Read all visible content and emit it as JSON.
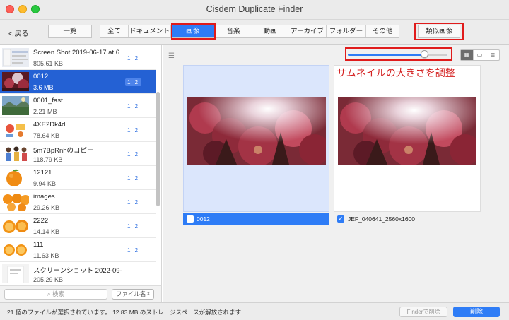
{
  "window": {
    "title": "Cisdem Duplicate Finder"
  },
  "toolbar": {
    "back_label": "< 戻る",
    "overview_label": "一覧",
    "categories": [
      {
        "label": "全て",
        "active": false
      },
      {
        "label": "ドキュメント",
        "active": false
      },
      {
        "label": "画像",
        "active": true
      },
      {
        "label": "音楽",
        "active": false
      },
      {
        "label": "動画",
        "active": false
      },
      {
        "label": "アーカイブ",
        "active": false
      },
      {
        "label": "フォルダー",
        "active": false
      },
      {
        "label": "その他",
        "active": false
      }
    ],
    "similar_images_label": "類似画像"
  },
  "sidebar": {
    "items": [
      {
        "name": "Screen Shot 2019-06-17 at 6....",
        "size": "805.61 KB",
        "badge": "1 2",
        "selected": false,
        "thumb": "screenshot"
      },
      {
        "name": "0012",
        "size": "3.6 MB",
        "badge": "1 2",
        "selected": true,
        "thumb": "autumn-tree"
      },
      {
        "name": "0001_fast",
        "size": "2.21 MB",
        "badge": "1 2",
        "selected": false,
        "thumb": "landscape"
      },
      {
        "name": "4XE2Dk4d",
        "size": "78.64 KB",
        "badge": "1 2",
        "selected": false,
        "thumb": "illustration"
      },
      {
        "name": "5m7BpRnhのコピー",
        "size": "118.79 KB",
        "badge": "1 2",
        "selected": false,
        "thumb": "people"
      },
      {
        "name": "12121",
        "size": "9.94 KB",
        "badge": "1 2",
        "selected": false,
        "thumb": "orange"
      },
      {
        "name": "images",
        "size": "29.26 KB",
        "badge": "1 2",
        "selected": false,
        "thumb": "oranges"
      },
      {
        "name": "2222",
        "size": "14.14 KB",
        "badge": "1 2",
        "selected": false,
        "thumb": "orange-slices"
      },
      {
        "name": "111",
        "size": "11.63 KB",
        "badge": "1 2",
        "selected": false,
        "thumb": "orange-halves"
      },
      {
        "name": "スクリーンショット 2022-09-0...",
        "size": "205.29 KB",
        "badge": "",
        "selected": false,
        "thumb": "screenshot-2"
      }
    ],
    "search_placeholder": "検索",
    "sort_label": "ファイル名"
  },
  "main": {
    "annotation": "サムネイルの大きさを調整",
    "thumb_size_fraction": 0.78,
    "view_icons": [
      "grid-view-icon",
      "filmstrip-view-icon",
      "list-view-icon"
    ],
    "cards": [
      {
        "label": "0012",
        "checked": false,
        "selected": true
      },
      {
        "label": "JEF_040641_2560x1600",
        "checked": true,
        "selected": false
      }
    ]
  },
  "footer": {
    "status": "21 個のファイルが選択されています。 12.83 MB のストレージスペースが解放されます",
    "finder_delete_label": "Finderで削除",
    "delete_label": "削除"
  },
  "colors": {
    "accent": "#2e7cf6",
    "highlight_box": "#e01b1b",
    "selected_row": "#2461d4"
  }
}
